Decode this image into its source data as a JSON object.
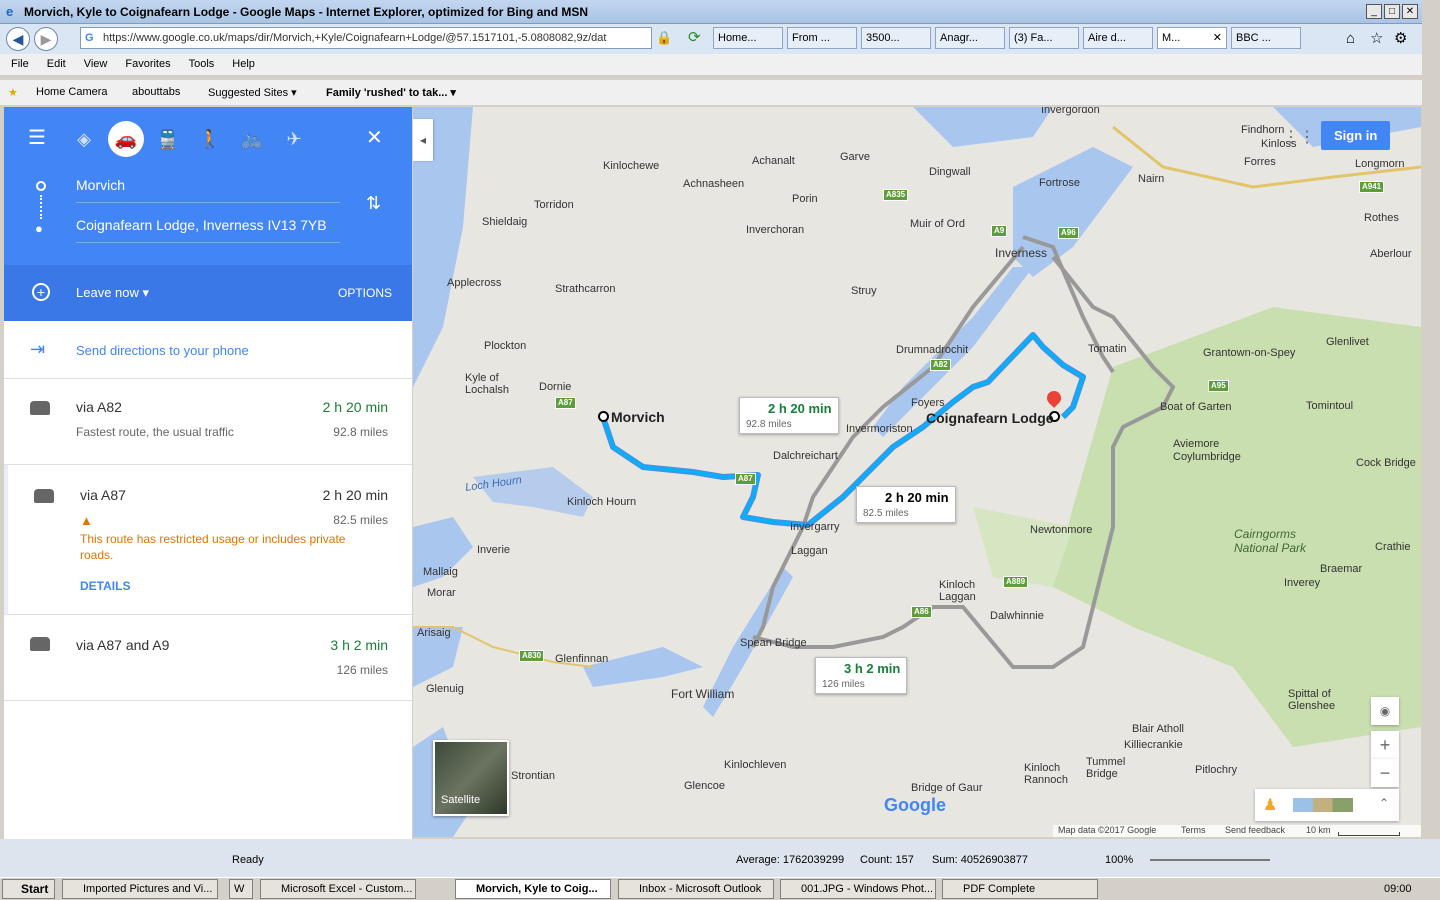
{
  "window": {
    "title": "Morvich, Kyle to Coignafearn Lodge - Google Maps - Internet Explorer, optimized for Bing and MSN"
  },
  "browser": {
    "url": "https://www.google.co.uk/maps/dir/Morvich,+Kyle/Coignafearn+Lodge/@57.1517101,-5.0808082,9z/dat",
    "tabs": [
      "Home...",
      "From ...",
      "3500...",
      "Anagr...",
      "(3) Fa...",
      "Aire d...",
      "M...",
      "BBC ..."
    ],
    "menu": [
      "File",
      "Edit",
      "View",
      "Favorites",
      "Tools",
      "Help"
    ],
    "favorites": [
      "Home Camera",
      "abouttabs",
      "Suggested Sites",
      "Family 'rushed' to tak..."
    ]
  },
  "panel": {
    "origin": "Morvich",
    "destination": "Coignafearn Lodge, Inverness IV13 7YB",
    "leave": "Leave now",
    "options": "OPTIONS",
    "send": "Send directions to your phone",
    "routes": [
      {
        "via": "via A82",
        "sub": "Fastest route, the usual traffic",
        "duration": "2 h 20 min",
        "distance": "92.8 miles"
      },
      {
        "via": "via A87",
        "warning": "This route has restricted usage or includes private roads.",
        "details": "DETAILS",
        "duration": "2 h 20 min",
        "distance": "82.5 miles"
      },
      {
        "via": "via A87 and A9",
        "duration": "3 h 2 min",
        "distance": "126 miles"
      }
    ]
  },
  "map": {
    "signin": "Sign in",
    "satellite": "Satellite",
    "google": "Google",
    "footer": [
      "Map data ©2017 Google",
      "Terms",
      "Send feedback",
      "10 km"
    ],
    "callouts": [
      {
        "d": "2 h 20 min",
        "m": "92.8 miles"
      },
      {
        "d": "2 h 20 min",
        "m": "82.5 miles"
      },
      {
        "d": "3 h 2 min",
        "m": "126 miles"
      }
    ],
    "start": "Morvich",
    "end": "Coignafearn Lodge",
    "places": [
      "Invergordon",
      "Findhorn",
      "Kinloss",
      "Forres",
      "Longmorn",
      "Kinlochewe",
      "Achanalt",
      "Garve",
      "Achnasheen",
      "Dingwall",
      "Fortrose",
      "Nairn",
      "Torridon",
      "Porin",
      "Shieldaig",
      "Inverchoran",
      "Muir of Ord",
      "Rothes",
      "Inverness",
      "Aberlour",
      "Applecross",
      "Strathcarron",
      "Struy",
      "Glenlivet",
      "Plockton",
      "Drumnadrochit",
      "Tomatin",
      "Grantown-on-Spey",
      "Kyle of Lochalsh",
      "Dornie",
      "Foyers",
      "Boat of Garten",
      "Tomintoul",
      "Invermoriston",
      "Aviemore",
      "Coylumbridge",
      "Dalchreichart",
      "Cock Bridge",
      "Loch Hourn",
      "Kinloch Hourn",
      "Invergarry",
      "Cairngorms National Park",
      "Newtonmore",
      "Crathie",
      "Inverie",
      "Laggan",
      "Braemar",
      "Mallaig",
      "Inverey",
      "Morar",
      "Kinloch Laggan",
      "Arisaig",
      "Dalwhinnie",
      "Spean Bridge",
      "Glenfinnan",
      "Fort William",
      "Glenuig",
      "Spittal of Glenshee",
      "Blair Atholl",
      "Killiecrankie",
      "Kinlochleven",
      "Strontian",
      "Tummel Bridge",
      "Kinloch Rannoch",
      "Pitlochry",
      "Glencoe",
      "Bridge of Gaur"
    ],
    "roads": [
      "A87",
      "A82",
      "A835",
      "A9",
      "A96",
      "A941",
      "A95",
      "A86",
      "A889",
      "A830",
      "A87"
    ]
  },
  "excel": {
    "ready": "Ready",
    "average": "Average: 1762039299",
    "count": "Count: 157",
    "sum": "Sum: 40526903877",
    "zoom": "100%"
  },
  "taskbar": {
    "start": "Start",
    "items": [
      "Imported Pictures and Vi...",
      "",
      "Microsoft Excel - Custom...",
      "Morvich, Kyle to Coig...",
      "Inbox - Microsoft Outlook",
      "001.JPG - Windows Phot...",
      "PDF Complete"
    ],
    "clock": "09:00"
  }
}
